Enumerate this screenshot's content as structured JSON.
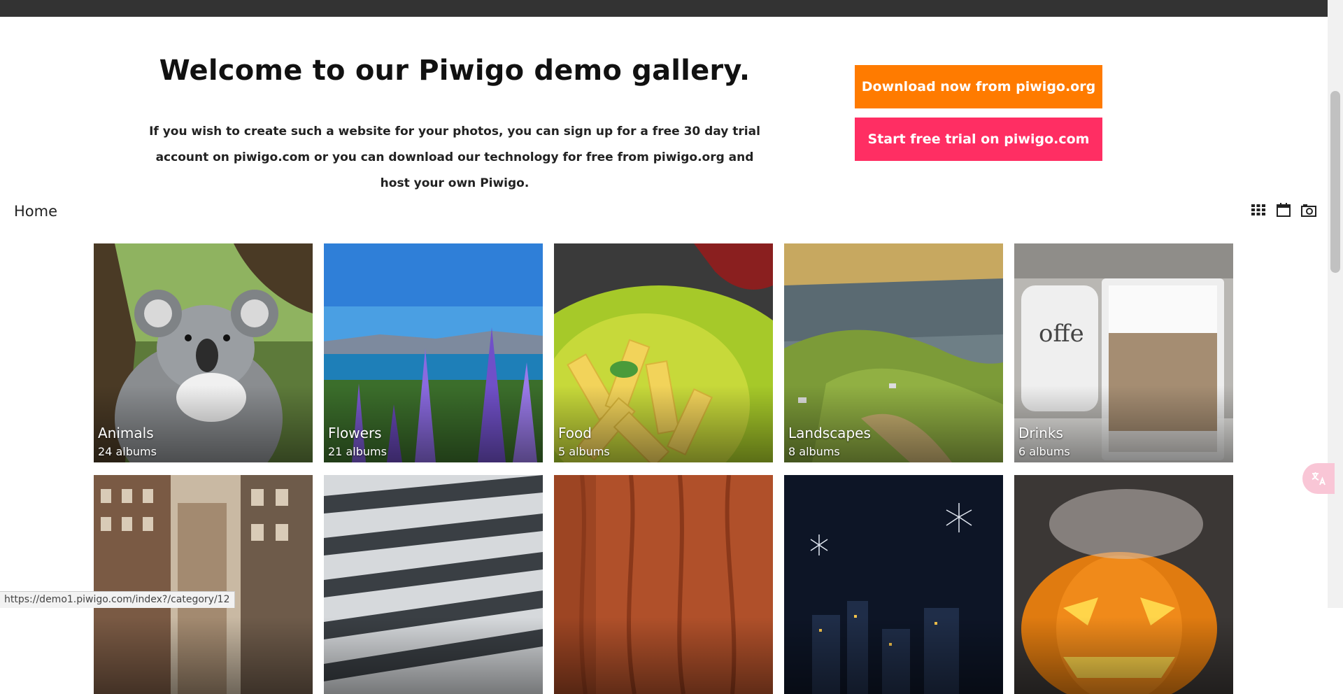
{
  "hero": {
    "title": "Welcome to our Piwigo demo gallery.",
    "text": "If you wish to create such a website for your photos, you can sign up for a free 30 day trial account on piwigo.com or you can download our technology for free from piwigo.org and host your own Piwigo."
  },
  "buttons": {
    "download": "Download now from piwigo.org",
    "trial": "Start free trial on piwigo.com"
  },
  "colors": {
    "download": "#ff7b00",
    "trial": "#ff2e63",
    "topbar": "#333333"
  },
  "breadcrumb": {
    "home": "Home"
  },
  "view_icons": [
    "grid-view-icon",
    "calendar-view-icon",
    "camera-view-icon"
  ],
  "albums": [
    {
      "name": "Animals",
      "count": "24 albums"
    },
    {
      "name": "Flowers",
      "count": "21 albums"
    },
    {
      "name": "Food",
      "count": "5 albums"
    },
    {
      "name": "Landscapes",
      "count": "8 albums"
    },
    {
      "name": "Drinks",
      "count": "6 albums"
    },
    {
      "name": "",
      "count": ""
    },
    {
      "name": "",
      "count": ""
    },
    {
      "name": "",
      "count": ""
    },
    {
      "name": "",
      "count": ""
    },
    {
      "name": "",
      "count": ""
    }
  ],
  "status": {
    "url": "https://demo1.piwigo.com/index?/category/12"
  }
}
